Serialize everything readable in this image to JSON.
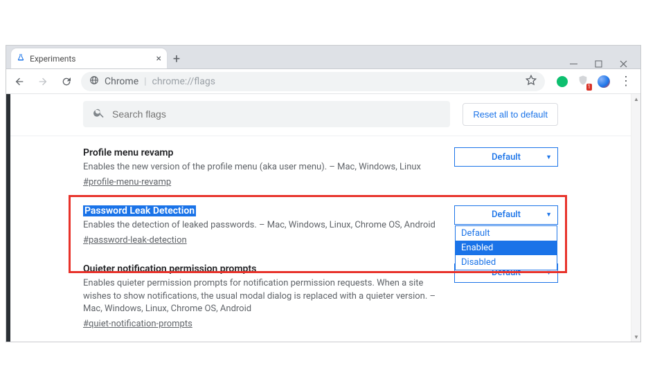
{
  "window": {
    "tab_title": "Experiments"
  },
  "omnibox": {
    "chrome_label": "Chrome",
    "path": "chrome://flags"
  },
  "search": {
    "placeholder": "Search flags",
    "reset_label": "Reset all to default"
  },
  "extensions": {
    "badge": "1"
  },
  "flags": [
    {
      "title": "Profile menu revamp",
      "desc": "Enables the new version of the profile menu (aka user menu). – Mac, Windows, Linux",
      "anchor": "#profile-menu-revamp",
      "select": "Default",
      "highlighted": false,
      "open": false
    },
    {
      "title": "Password Leak Detection",
      "desc": "Enables the detection of leaked passwords. – Mac, Windows, Linux, Chrome OS, Android",
      "anchor": "#password-leak-detection",
      "select": "Default",
      "highlighted": true,
      "open": true
    },
    {
      "title": "Quieter notification permission prompts",
      "desc": "Enables quieter permission prompts for notification permission requests. When a site wishes to show notifications, the usual modal dialog is replaced with a quieter version. – Mac, Windows, Linux, Chrome OS, Android",
      "anchor": "#quiet-notification-prompts",
      "select": "Default",
      "highlighted": false,
      "open": false
    }
  ],
  "dropdown_options": [
    "Default",
    "Enabled",
    "Disabled"
  ],
  "dropdown_selected": "Enabled"
}
